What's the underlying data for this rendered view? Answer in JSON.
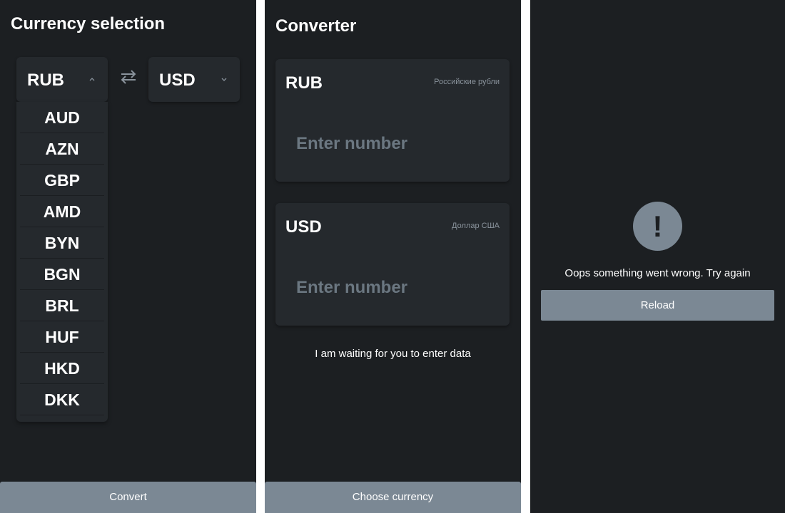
{
  "selection_screen": {
    "title": "Currency selection",
    "from_currency": "RUB",
    "to_currency": "USD",
    "dropdown_options": [
      "AUD",
      "AZN",
      "GBP",
      "AMD",
      "BYN",
      "BGN",
      "BRL",
      "HUF",
      "HKD",
      "DKK"
    ],
    "convert_label": "Convert",
    "icons": {
      "from_chevron": "chevron-up-icon",
      "to_chevron": "chevron-down-icon",
      "swap": "swap-arrows-icon"
    }
  },
  "converter_screen": {
    "title": "Converter",
    "from_card": {
      "code": "RUB",
      "name": "Российские рубли",
      "placeholder": "Enter number"
    },
    "to_card": {
      "code": "USD",
      "name": "Доллар США",
      "placeholder": "Enter number"
    },
    "status_text": "I am waiting for you to enter data",
    "choose_label": "Choose currency"
  },
  "error_screen": {
    "icon": "exclamation-icon",
    "icon_glyph": "!",
    "message": "Oops something went wrong. Try again",
    "reload_label": "Reload"
  },
  "colors": {
    "background": "#1c1f22",
    "card": "#25292d",
    "button": "#7b8894",
    "muted_text": "#8a939c",
    "placeholder": "#6b7781"
  }
}
